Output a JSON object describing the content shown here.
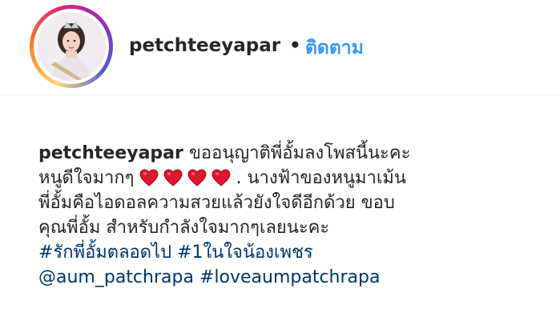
{
  "header": {
    "username": "petchteeyapar",
    "separator": "•",
    "follow_label": "ติดตาม"
  },
  "caption": {
    "username": "petchteeyapar",
    "line1_text": " ขออนุญาติพี่อั้มลงโพสนี้นะคะ",
    "line2_text": "หนูดีใจมากๆ ",
    "line2_after_hearts": ". นางฟ้าของหนูมาเม้น",
    "line3_text": "พี่อั้มคือไอดอลความสวยแล้วยังใจดีอีกด้วย ขอบ",
    "line4_text": "คุณพี่อั้ม สำหรับกำลังใจมากๆเลยนะคะ",
    "hashtag1": "#รักพี่อั้มตลอดไป",
    "hashtag2": "#1ในใจน้องเพชร",
    "mention": "@aum_patchrapa",
    "hashtag3": "#loveaumpatchrapa",
    "hearts": [
      "heart-emoji",
      "heart-emoji",
      "heart-emoji",
      "heart-emoji"
    ]
  },
  "colors": {
    "follow": "#3897f0",
    "hashtag": "#003569",
    "heart": "#e0162b",
    "text": "#262626"
  }
}
